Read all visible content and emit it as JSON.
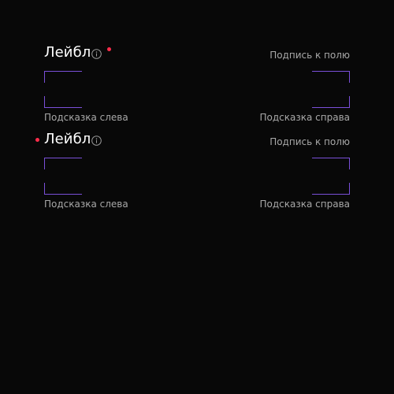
{
  "fields": [
    {
      "label": "Лейбл",
      "caption": "Подпись к полю",
      "value": "",
      "hint_left": "Подсказка слева",
      "hint_right": "Подсказка справа",
      "required_indicator": "after-label",
      "info_icon": "info-circle-icon"
    },
    {
      "label": "Лейбл",
      "caption": "Подпись к полю",
      "value": "",
      "hint_left": "Подсказка слева",
      "hint_right": "Подсказка справа",
      "required_indicator": "before-label",
      "info_icon": "info-circle-icon"
    }
  ],
  "colors": {
    "background": "#080808",
    "label": "#ffffff",
    "secondary_text": "#a8a8a8",
    "accent_border": "#7a4fd8",
    "required": "#ff2d4b"
  }
}
